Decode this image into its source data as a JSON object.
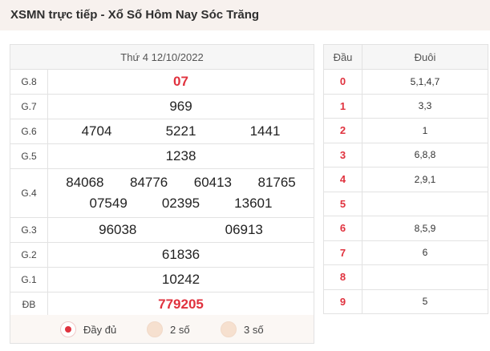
{
  "header": {
    "title": "XSMN trực tiếp - Xổ Số Hôm Nay Sóc Trăng"
  },
  "results": {
    "date": "Thứ 4 12/10/2022",
    "prizes": [
      {
        "label": "G.8",
        "numbers": [
          "07"
        ]
      },
      {
        "label": "G.7",
        "numbers": [
          "969"
        ]
      },
      {
        "label": "G.6",
        "numbers": [
          "4704",
          "5221",
          "1441"
        ]
      },
      {
        "label": "G.5",
        "numbers": [
          "1238"
        ]
      },
      {
        "label": "G.4",
        "numbers": [
          "84068",
          "84776",
          "60413",
          "81765",
          "07549",
          "02395",
          "13601"
        ]
      },
      {
        "label": "G.3",
        "numbers": [
          "96038",
          "06913"
        ]
      },
      {
        "label": "G.2",
        "numbers": [
          "61836"
        ]
      },
      {
        "label": "G.1",
        "numbers": [
          "10242"
        ]
      },
      {
        "label": "ĐB",
        "numbers": [
          "779205"
        ]
      }
    ]
  },
  "options": [
    {
      "label": "Đầy đủ",
      "checked": true
    },
    {
      "label": "2 số",
      "checked": false
    },
    {
      "label": "3 số",
      "checked": false
    }
  ],
  "loto": {
    "col_head": "Đầu",
    "col_tail": "Đuôi",
    "rows": [
      {
        "head": "0",
        "tail": "5,1,4,7"
      },
      {
        "head": "1",
        "tail": "3,3"
      },
      {
        "head": "2",
        "tail": "1"
      },
      {
        "head": "3",
        "tail": "6,8,8"
      },
      {
        "head": "4",
        "tail": "2,9,1"
      },
      {
        "head": "5",
        "tail": ""
      },
      {
        "head": "6",
        "tail": "8,5,9"
      },
      {
        "head": "7",
        "tail": "6"
      },
      {
        "head": "8",
        "tail": ""
      },
      {
        "head": "9",
        "tail": "5"
      }
    ]
  },
  "colors": {
    "accent": "#e0323e",
    "header_bg": "#f7f1ee"
  }
}
